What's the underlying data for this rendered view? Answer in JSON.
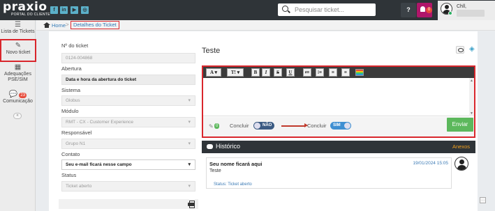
{
  "header": {
    "logo_word": "praxio",
    "logo_sub": "PORTAL DO CLIENTE",
    "social": [
      "f",
      "in",
      "▶",
      "◎"
    ],
    "search_placeholder": "Pesquisar ticket...",
    "help_label": "?",
    "notification_count": "0",
    "user_name": "Chll,"
  },
  "sidebar": {
    "items": [
      {
        "icon": "list-icon",
        "label": "Lista de Tickets"
      },
      {
        "icon": "edit-icon",
        "label": "Novo ticket"
      },
      {
        "icon": "calendar-icon",
        "label": "Adequações PSE/SIM"
      },
      {
        "icon": "chat-icon",
        "label": "Comunicação",
        "badge": "23"
      }
    ],
    "collapse_label": "«"
  },
  "breadcrumb": {
    "home": "Home",
    "separator": ">",
    "current": "Detalhes do Ticket"
  },
  "form": {
    "ticket_number_label": "Nº do ticket",
    "ticket_number": "0124-004868",
    "opening_label": "Abertura",
    "opening_value": "Data e hora da abertura do ticket",
    "system_label": "Sistema",
    "system_value": "Globus",
    "module_label": "Módulo",
    "module_value": "RMT - CX - Customer Experience",
    "responsible_label": "Responsável",
    "responsible_value": "Grupo N1",
    "contact_label": "Contato",
    "contact_value": "Seu e-mail ficará nesse campo",
    "status_label": "Status",
    "status_value": "Ticket aberto"
  },
  "ticket": {
    "title": "Teste"
  },
  "editor": {
    "toolbar": [
      "A ▾",
      "T! ▾",
      "B",
      "I",
      "S",
      "U",
      "≔",
      "⁝≡",
      "≡",
      "≡"
    ],
    "attachments_count": "0",
    "conclude_label": "Concluir",
    "toggle_no": "NÃO",
    "toggle_yes": "SIM",
    "send_label": "Enviar"
  },
  "history": {
    "title": "Histórico",
    "attachments_label": "Anexos",
    "message": {
      "author": "Seu nome ficará aqui",
      "timestamp": "19/01/2024 15:05",
      "text": "Teste",
      "status": "Status: Ticket aberto"
    }
  },
  "colors": {
    "topbar": "#2f3438",
    "highlight": "#d9262c",
    "send": "#5cb85c",
    "link": "#337ab7"
  }
}
